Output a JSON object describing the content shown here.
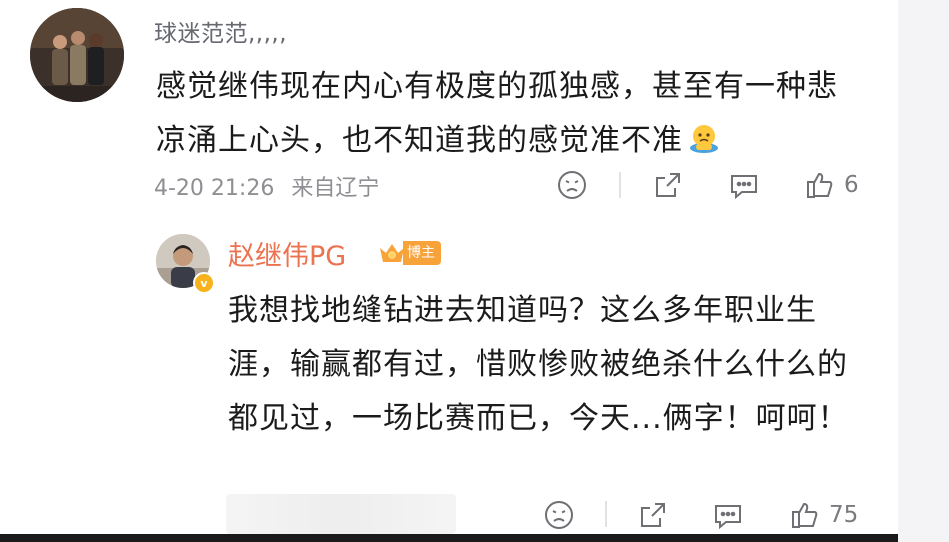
{
  "comment": {
    "username": "球迷范范,,,,,",
    "text": "感觉继伟现在内心有极度的孤独感，甚至有一种悲凉涌上心头，也不知道我的感觉准不准",
    "emoji_icon": "crying-face-emoji",
    "date": "4-20 21:26",
    "location": "来自辽宁",
    "like_count": "6"
  },
  "reply": {
    "username": "赵继伟PG",
    "badge_label": "博主",
    "verified_mark": "v",
    "text": "我想找地缝钻进去知道吗？这么多年职业生涯，输赢都有过，惜败惨败被绝杀什么什么的都见过，一场比赛而已，今天...俩字！呵呵！",
    "like_count": "75"
  },
  "colors": {
    "reply_name": "#eb7350",
    "badge": "#f8a23a",
    "meta_gray": "#8e8e93"
  },
  "icons": [
    "dislike-icon",
    "share-icon",
    "comment-icon",
    "like-icon"
  ]
}
